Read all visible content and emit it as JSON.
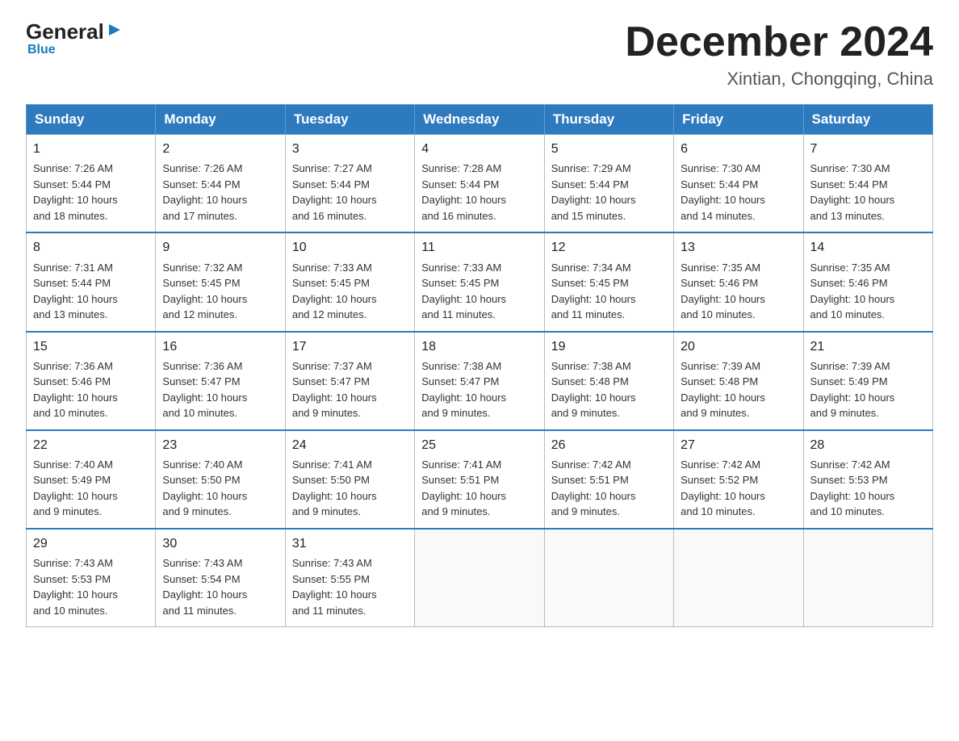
{
  "header": {
    "logo_general": "General",
    "logo_blue": "Blue",
    "logo_arrow": "▶",
    "month_title": "December 2024",
    "location": "Xintian, Chongqing, China"
  },
  "days_of_week": [
    "Sunday",
    "Monday",
    "Tuesday",
    "Wednesday",
    "Thursday",
    "Friday",
    "Saturday"
  ],
  "weeks": [
    [
      {
        "day": "1",
        "sunrise": "7:26 AM",
        "sunset": "5:44 PM",
        "daylight": "10 hours and 18 minutes."
      },
      {
        "day": "2",
        "sunrise": "7:26 AM",
        "sunset": "5:44 PM",
        "daylight": "10 hours and 17 minutes."
      },
      {
        "day": "3",
        "sunrise": "7:27 AM",
        "sunset": "5:44 PM",
        "daylight": "10 hours and 16 minutes."
      },
      {
        "day": "4",
        "sunrise": "7:28 AM",
        "sunset": "5:44 PM",
        "daylight": "10 hours and 16 minutes."
      },
      {
        "day": "5",
        "sunrise": "7:29 AM",
        "sunset": "5:44 PM",
        "daylight": "10 hours and 15 minutes."
      },
      {
        "day": "6",
        "sunrise": "7:30 AM",
        "sunset": "5:44 PM",
        "daylight": "10 hours and 14 minutes."
      },
      {
        "day": "7",
        "sunrise": "7:30 AM",
        "sunset": "5:44 PM",
        "daylight": "10 hours and 13 minutes."
      }
    ],
    [
      {
        "day": "8",
        "sunrise": "7:31 AM",
        "sunset": "5:44 PM",
        "daylight": "10 hours and 13 minutes."
      },
      {
        "day": "9",
        "sunrise": "7:32 AM",
        "sunset": "5:45 PM",
        "daylight": "10 hours and 12 minutes."
      },
      {
        "day": "10",
        "sunrise": "7:33 AM",
        "sunset": "5:45 PM",
        "daylight": "10 hours and 12 minutes."
      },
      {
        "day": "11",
        "sunrise": "7:33 AM",
        "sunset": "5:45 PM",
        "daylight": "10 hours and 11 minutes."
      },
      {
        "day": "12",
        "sunrise": "7:34 AM",
        "sunset": "5:45 PM",
        "daylight": "10 hours and 11 minutes."
      },
      {
        "day": "13",
        "sunrise": "7:35 AM",
        "sunset": "5:46 PM",
        "daylight": "10 hours and 10 minutes."
      },
      {
        "day": "14",
        "sunrise": "7:35 AM",
        "sunset": "5:46 PM",
        "daylight": "10 hours and 10 minutes."
      }
    ],
    [
      {
        "day": "15",
        "sunrise": "7:36 AM",
        "sunset": "5:46 PM",
        "daylight": "10 hours and 10 minutes."
      },
      {
        "day": "16",
        "sunrise": "7:36 AM",
        "sunset": "5:47 PM",
        "daylight": "10 hours and 10 minutes."
      },
      {
        "day": "17",
        "sunrise": "7:37 AM",
        "sunset": "5:47 PM",
        "daylight": "10 hours and 9 minutes."
      },
      {
        "day": "18",
        "sunrise": "7:38 AM",
        "sunset": "5:47 PM",
        "daylight": "10 hours and 9 minutes."
      },
      {
        "day": "19",
        "sunrise": "7:38 AM",
        "sunset": "5:48 PM",
        "daylight": "10 hours and 9 minutes."
      },
      {
        "day": "20",
        "sunrise": "7:39 AM",
        "sunset": "5:48 PM",
        "daylight": "10 hours and 9 minutes."
      },
      {
        "day": "21",
        "sunrise": "7:39 AM",
        "sunset": "5:49 PM",
        "daylight": "10 hours and 9 minutes."
      }
    ],
    [
      {
        "day": "22",
        "sunrise": "7:40 AM",
        "sunset": "5:49 PM",
        "daylight": "10 hours and 9 minutes."
      },
      {
        "day": "23",
        "sunrise": "7:40 AM",
        "sunset": "5:50 PM",
        "daylight": "10 hours and 9 minutes."
      },
      {
        "day": "24",
        "sunrise": "7:41 AM",
        "sunset": "5:50 PM",
        "daylight": "10 hours and 9 minutes."
      },
      {
        "day": "25",
        "sunrise": "7:41 AM",
        "sunset": "5:51 PM",
        "daylight": "10 hours and 9 minutes."
      },
      {
        "day": "26",
        "sunrise": "7:42 AM",
        "sunset": "5:51 PM",
        "daylight": "10 hours and 9 minutes."
      },
      {
        "day": "27",
        "sunrise": "7:42 AM",
        "sunset": "5:52 PM",
        "daylight": "10 hours and 10 minutes."
      },
      {
        "day": "28",
        "sunrise": "7:42 AM",
        "sunset": "5:53 PM",
        "daylight": "10 hours and 10 minutes."
      }
    ],
    [
      {
        "day": "29",
        "sunrise": "7:43 AM",
        "sunset": "5:53 PM",
        "daylight": "10 hours and 10 minutes."
      },
      {
        "day": "30",
        "sunrise": "7:43 AM",
        "sunset": "5:54 PM",
        "daylight": "10 hours and 11 minutes."
      },
      {
        "day": "31",
        "sunrise": "7:43 AM",
        "sunset": "5:55 PM",
        "daylight": "10 hours and 11 minutes."
      },
      null,
      null,
      null,
      null
    ]
  ],
  "labels": {
    "sunrise": "Sunrise:",
    "sunset": "Sunset:",
    "daylight": "Daylight:"
  }
}
